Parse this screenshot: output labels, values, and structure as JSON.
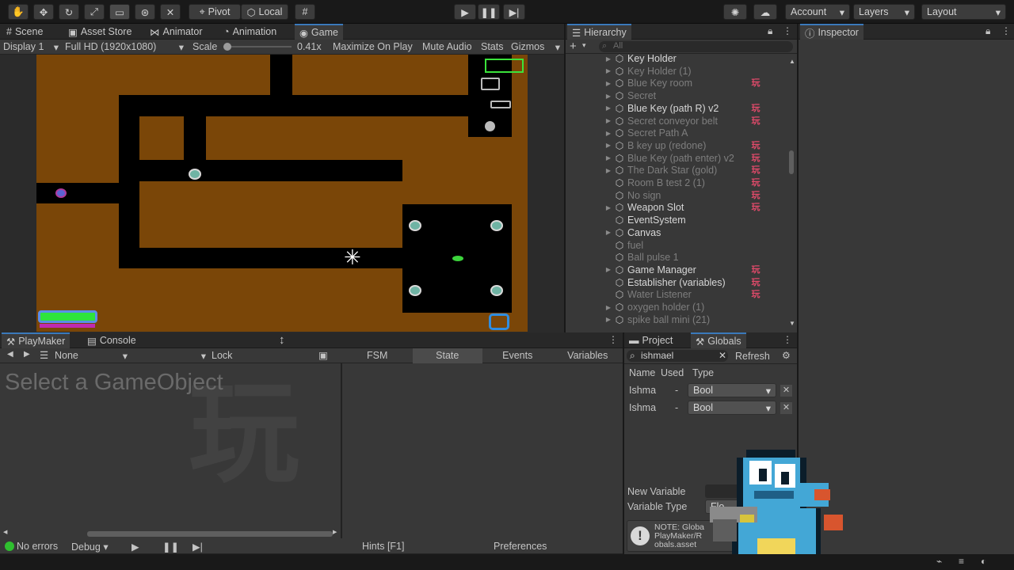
{
  "toolbar": {
    "pivot_label": "Pivot",
    "local_label": "Local",
    "account_label": "Account",
    "layers_label": "Layers",
    "layout_label": "Layout"
  },
  "scene_tabs": [
    "Scene",
    "Asset Store",
    "Animator",
    "Animation",
    "Game"
  ],
  "game_bar": {
    "display": "Display 1",
    "resolution": "Full HD (1920x1080)",
    "scale_label": "Scale",
    "scale_value": "0.41x",
    "maximize": "Maximize On Play",
    "mute": "Mute Audio",
    "stats": "Stats",
    "gizmos": "Gizmos"
  },
  "hierarchy": {
    "title": "Hierarchy",
    "search_placeholder": "All",
    "items": [
      {
        "label": "Key Holder",
        "active": true,
        "arrow": true,
        "badge": false
      },
      {
        "label": "Key Holder (1)",
        "active": false,
        "arrow": true,
        "badge": false
      },
      {
        "label": "Blue Key room",
        "active": false,
        "arrow": true,
        "badge": true
      },
      {
        "label": "Secret",
        "active": false,
        "arrow": true,
        "badge": false
      },
      {
        "label": "Blue Key (path R) v2",
        "active": true,
        "arrow": true,
        "badge": true
      },
      {
        "label": "Secret conveyor belt",
        "active": false,
        "arrow": true,
        "badge": true
      },
      {
        "label": "Secret Path A",
        "active": false,
        "arrow": true,
        "badge": false
      },
      {
        "label": "B key up (redone)",
        "active": false,
        "arrow": true,
        "badge": true
      },
      {
        "label": "Blue Key (path enter) v2",
        "active": false,
        "arrow": true,
        "badge": true
      },
      {
        "label": "The Dark Star (gold)",
        "active": false,
        "arrow": true,
        "badge": true
      },
      {
        "label": "Room B test 2 (1)",
        "active": false,
        "arrow": false,
        "badge": true
      },
      {
        "label": "No sign",
        "active": false,
        "arrow": false,
        "badge": true
      },
      {
        "label": "Weapon Slot",
        "active": true,
        "arrow": true,
        "badge": true
      },
      {
        "label": "EventSystem",
        "active": true,
        "arrow": false,
        "badge": false
      },
      {
        "label": "Canvas",
        "active": true,
        "arrow": true,
        "badge": false
      },
      {
        "label": "fuel",
        "active": false,
        "arrow": false,
        "badge": false
      },
      {
        "label": "Ball pulse 1",
        "active": false,
        "arrow": false,
        "badge": false
      },
      {
        "label": "Game Manager",
        "active": true,
        "arrow": true,
        "badge": true
      },
      {
        "label": "Establisher (variables)",
        "active": true,
        "arrow": false,
        "badge": true
      },
      {
        "label": "Water Listener",
        "active": false,
        "arrow": false,
        "badge": true
      },
      {
        "label": "oxygen holder (1)",
        "active": false,
        "arrow": true,
        "badge": false
      },
      {
        "label": "spike ball mini (21)",
        "active": false,
        "arrow": true,
        "badge": false
      }
    ]
  },
  "inspector": {
    "title": "Inspector"
  },
  "playmaker": {
    "tab": "PlayMaker",
    "console_tab": "Console",
    "selector": "None",
    "lock": "Lock",
    "tabs": [
      "FSM",
      "State",
      "Events",
      "Variables"
    ],
    "placeholder": "Select a GameObject",
    "status": "No errors",
    "debug": "Debug",
    "hints": "Hints [F1]",
    "preferences": "Preferences"
  },
  "globals": {
    "project_tab": "Project",
    "globals_tab": "Globals",
    "search_value": "ishmael",
    "refresh": "Refresh",
    "col_name": "Name",
    "col_used": "Used",
    "col_type": "Type",
    "rows": [
      {
        "name": "Ishma",
        "used": "-",
        "type": "Bool"
      },
      {
        "name": "Ishma",
        "used": "-",
        "type": "Bool"
      }
    ],
    "new_variable": "New Variable",
    "variable_type": "Variable Type",
    "variable_type_value": "Flo",
    "note_line1": "NOTE: Globa",
    "note_line2": "PlayMaker/R",
    "note_line3": "obals.asset"
  }
}
